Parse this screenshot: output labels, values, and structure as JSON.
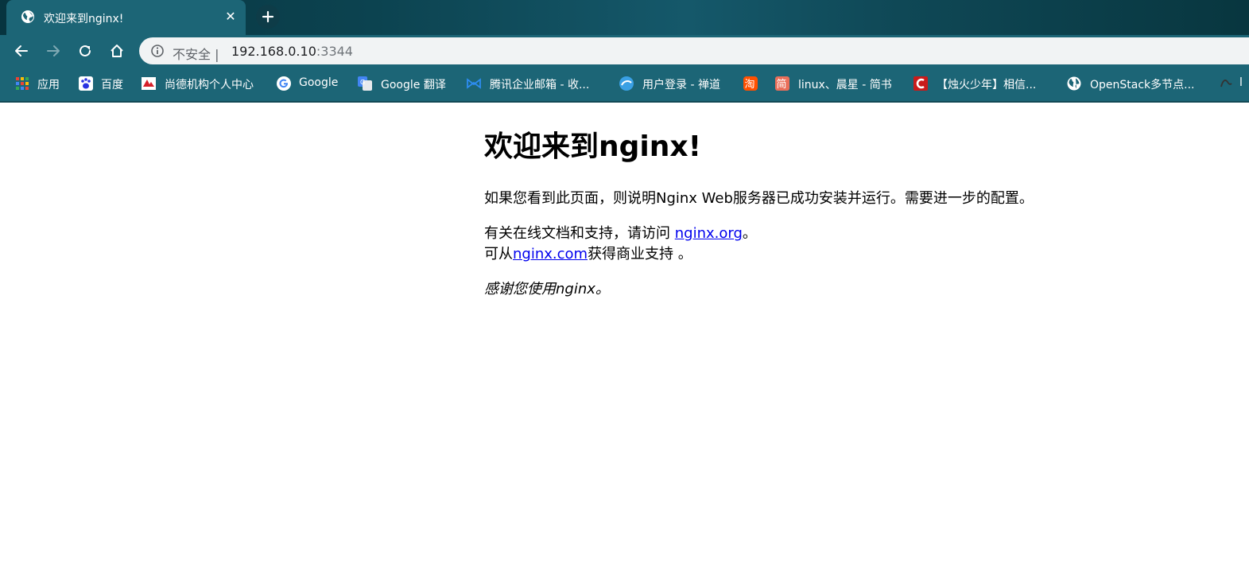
{
  "tab": {
    "title": "欢迎来到nginx!",
    "close": "✕"
  },
  "toolbar": {
    "security_label": "不安全 |",
    "url_host": "192.168.0.10",
    "url_port": ":3344"
  },
  "bookmarks": [
    {
      "label": "应用",
      "icon": "apps-grid-icon"
    },
    {
      "label": "百度",
      "icon": "baidu-icon"
    },
    {
      "label": "尚德机构个人中心",
      "icon": "sunlands-icon"
    },
    {
      "label": "Google",
      "icon": "google-icon"
    },
    {
      "label": "Google 翻译",
      "icon": "google-translate-icon"
    },
    {
      "label": "腾讯企业邮箱 - 收...",
      "icon": "tencent-mail-icon"
    },
    {
      "label": "用户登录 - 禅道",
      "icon": "zentao-icon"
    },
    {
      "label": "",
      "icon": "taobao-icon"
    },
    {
      "label": "linux、晨星 - 简书",
      "icon": "jianshu-icon"
    },
    {
      "label": "【烛火少年】相信...",
      "icon": "csdn-icon"
    },
    {
      "label": "OpenStack多节点...",
      "icon": "globe-icon"
    },
    {
      "label": "l",
      "icon": "extension-icon"
    }
  ],
  "page": {
    "heading": "欢迎来到nginx!",
    "para1": "如果您看到此页面，则说明Nginx Web服务器已成功安装并运行。需要进一步的配置。",
    "para2_prefix": "有关在线文档和支持，请访问 ",
    "para2_link": "nginx.org",
    "para2_suffix": "。",
    "para3_prefix": "可从",
    "para3_link": "nginx.com",
    "para3_suffix": "获得商业支持 。",
    "thanks": "感谢您使用nginx。"
  },
  "colors": {
    "chrome_bg": "#1c6576",
    "link": "#0000ee"
  }
}
